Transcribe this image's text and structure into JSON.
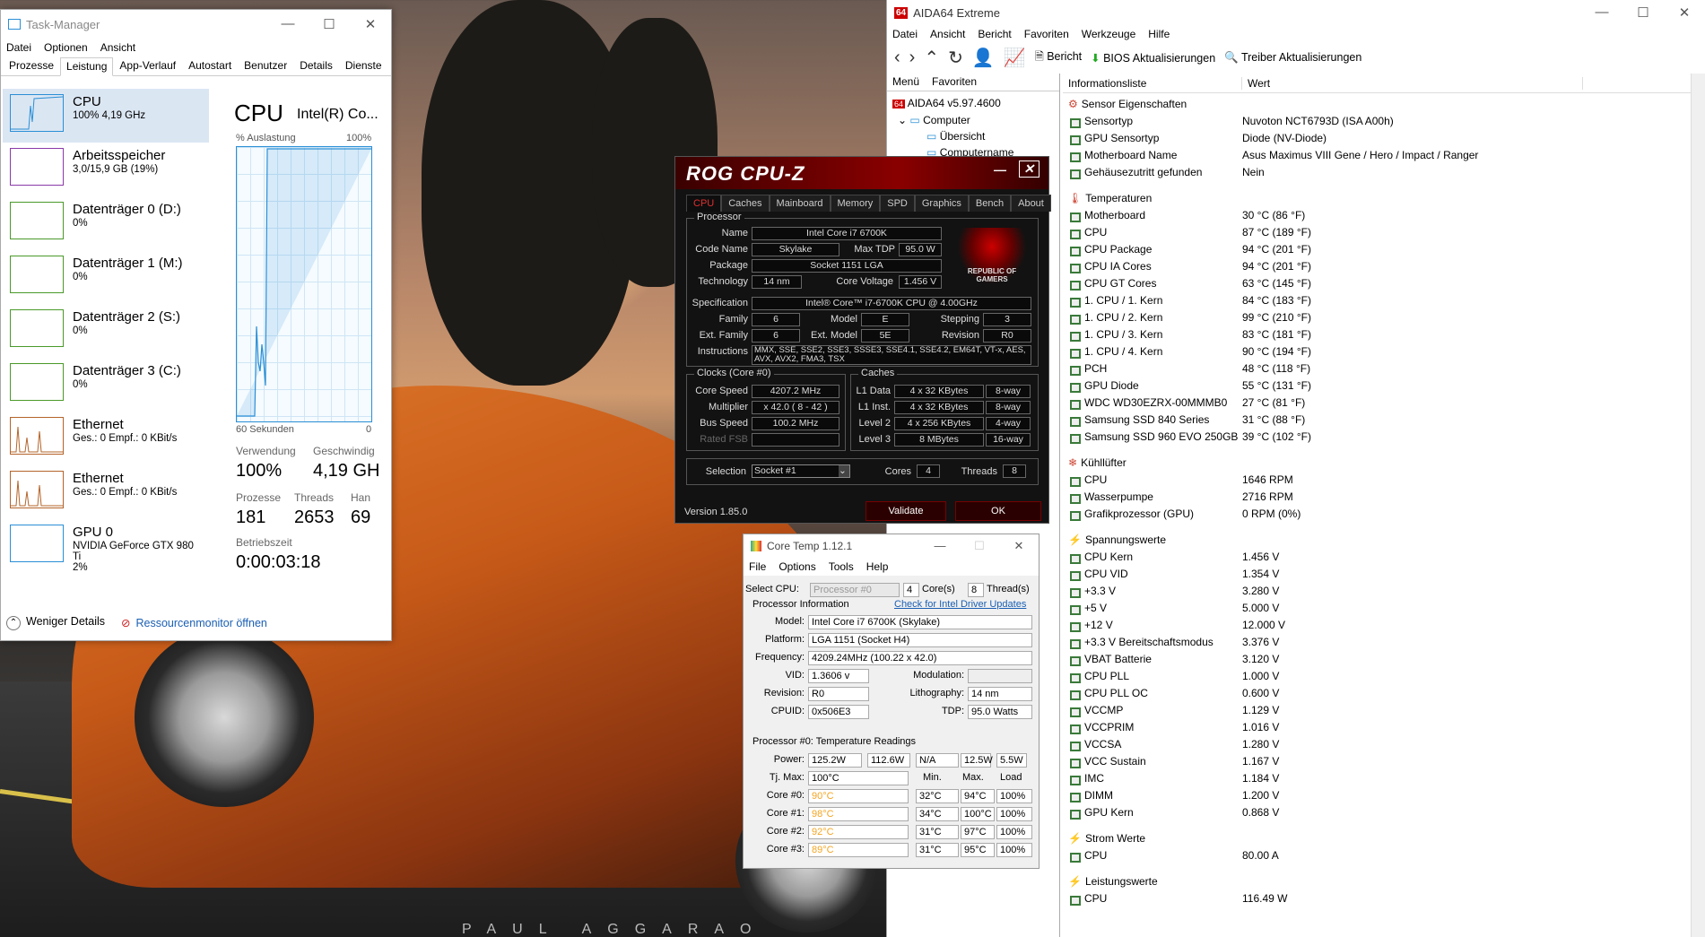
{
  "wallpaper": {
    "signature": "PAUL AGGARAO"
  },
  "taskmanager": {
    "title": "Task-Manager",
    "menu": [
      "Datei",
      "Optionen",
      "Ansicht"
    ],
    "tabs": [
      "Prozesse",
      "Leistung",
      "App-Verlauf",
      "Autostart",
      "Benutzer",
      "Details",
      "Dienste"
    ],
    "active_tab": "Leistung",
    "items": [
      {
        "name": "CPU",
        "sub": "100% 4,19 GHz",
        "color": "#2a8fd6"
      },
      {
        "name": "Arbeitsspeicher",
        "sub": "3,0/15,9 GB (19%)",
        "color": "#8b3aa8"
      },
      {
        "name": "Datenträger 0 (D:)",
        "sub": "0%",
        "color": "#4a9a2a"
      },
      {
        "name": "Datenträger 1 (M:)",
        "sub": "0%",
        "color": "#4a9a2a"
      },
      {
        "name": "Datenträger 2 (S:)",
        "sub": "0%",
        "color": "#4a9a2a"
      },
      {
        "name": "Datenträger 3 (C:)",
        "sub": "0%",
        "color": "#4a9a2a"
      },
      {
        "name": "Ethernet",
        "sub": "Ges.: 0 Empf.: 0 KBit/s",
        "color": "#b4642a"
      },
      {
        "name": "Ethernet",
        "sub": "Ges.: 0 Empf.: 0 KBit/s",
        "color": "#b4642a"
      },
      {
        "name": "GPU 0",
        "sub": "NVIDIA GeForce GTX 980 Ti",
        "sub2": "2%",
        "color": "#2a8fd6"
      }
    ],
    "detail": {
      "title": "CPU",
      "model": "Intel(R) Co...",
      "util_label": "% Auslastung",
      "util_max": "100%",
      "x_left": "60 Sekunden",
      "x_right": "0",
      "use_label": "Verwendung",
      "use_val": "100%",
      "speed_label": "Geschwindig",
      "speed_val": "4,19 GH",
      "proc_label": "Prozesse",
      "proc_val": "181",
      "threads_label": "Threads",
      "threads_val": "2653",
      "han_label": "Han",
      "han_val": "69",
      "uptime_label": "Betriebszeit",
      "uptime_val": "0:00:03:18"
    },
    "footer": {
      "less": "Weniger Details",
      "monitor": "Ressourcenmonitor öffnen"
    }
  },
  "aida": {
    "title": "AIDA64 Extreme",
    "menu": [
      "Datei",
      "Ansicht",
      "Bericht",
      "Favoriten",
      "Werkzeuge",
      "Hilfe"
    ],
    "toolbar": {
      "report": "Bericht",
      "bios": "BIOS Aktualisierungen",
      "driver": "Treiber Aktualisierungen"
    },
    "tabs": [
      "Menü",
      "Favoriten"
    ],
    "tree": [
      "AIDA64 v5.97.4600",
      "Computer",
      "Übersicht",
      "Computername"
    ],
    "col_info": "Informationsliste",
    "col_val": "Wert",
    "sections": [
      {
        "title": "Sensor Eigenschaften",
        "rows": [
          [
            "Sensortyp",
            "Nuvoton NCT6793D  (ISA A00h)"
          ],
          [
            "GPU Sensortyp",
            "Diode  (NV-Diode)"
          ],
          [
            "Motherboard Name",
            "Asus Maximus VIII Gene / Hero / Impact / Ranger"
          ],
          [
            "Gehäusezutritt gefunden",
            "Nein"
          ]
        ]
      },
      {
        "title": "Temperaturen",
        "rows": [
          [
            "Motherboard",
            "30 °C  (86 °F)"
          ],
          [
            "CPU",
            "87 °C  (189 °F)"
          ],
          [
            "CPU Package",
            "94 °C  (201 °F)"
          ],
          [
            "CPU IA Cores",
            "94 °C  (201 °F)"
          ],
          [
            "CPU GT Cores",
            "63 °C  (145 °F)"
          ],
          [
            "1. CPU / 1. Kern",
            "84 °C  (183 °F)"
          ],
          [
            "1. CPU / 2. Kern",
            "99 °C  (210 °F)"
          ],
          [
            "1. CPU / 3. Kern",
            "83 °C  (181 °F)"
          ],
          [
            "1. CPU / 4. Kern",
            "90 °C  (194 °F)"
          ],
          [
            "PCH",
            "48 °C  (118 °F)"
          ],
          [
            "GPU Diode",
            "55 °C  (131 °F)"
          ],
          [
            "WDC WD30EZRX-00MMMB0",
            "27 °C  (81 °F)"
          ],
          [
            "Samsung SSD 840 Series",
            "31 °C  (88 °F)"
          ],
          [
            "Samsung SSD 960 EVO 250GB",
            "39 °C  (102 °F)"
          ]
        ]
      },
      {
        "title": "Kühllüfter",
        "rows": [
          [
            "CPU",
            "1646 RPM"
          ],
          [
            "Wasserpumpe",
            "2716 RPM"
          ],
          [
            "Grafikprozessor (GPU)",
            "0 RPM  (0%)"
          ]
        ]
      },
      {
        "title": "Spannungswerte",
        "rows": [
          [
            "CPU Kern",
            "1.456 V"
          ],
          [
            "CPU VID",
            "1.354 V"
          ],
          [
            "+3.3 V",
            "3.280 V"
          ],
          [
            "+5 V",
            "5.000 V"
          ],
          [
            "+12 V",
            "12.000 V"
          ],
          [
            "+3.3 V Bereitschaftsmodus",
            "3.376 V"
          ],
          [
            "VBAT Batterie",
            "3.120 V"
          ],
          [
            "CPU PLL",
            "1.000 V"
          ],
          [
            "CPU PLL OC",
            "0.600 V"
          ],
          [
            "VCCMP",
            "1.129 V"
          ],
          [
            "VCCPRIM",
            "1.016 V"
          ],
          [
            "VCCSA",
            "1.280 V"
          ],
          [
            "VCC Sustain",
            "1.167 V"
          ],
          [
            "IMC",
            "1.184 V"
          ],
          [
            "DIMM",
            "1.200 V"
          ],
          [
            "GPU Kern",
            "0.868 V"
          ]
        ]
      },
      {
        "title": "Strom Werte",
        "rows": [
          [
            "CPU",
            "80.00 A"
          ]
        ]
      },
      {
        "title": "Leistungswerte",
        "rows": [
          [
            "CPU",
            "116.49 W"
          ]
        ]
      }
    ]
  },
  "cpuz": {
    "title": "ROG CPU-Z",
    "tabs": [
      "CPU",
      "Caches",
      "Mainboard",
      "Memory",
      "SPD",
      "Graphics",
      "Bench",
      "About"
    ],
    "processor_label": "Processor",
    "logo": "REPUBLIC OF GAMERS",
    "fields": {
      "name_l": "Name",
      "name": "Intel Core i7 6700K",
      "code_l": "Code Name",
      "code": "Skylake",
      "tdp_l": "Max TDP",
      "tdp": "95.0 W",
      "pkg_l": "Package",
      "pkg": "Socket 1151 LGA",
      "tech_l": "Technology",
      "tech": "14 nm",
      "cv_l": "Core Voltage",
      "cv": "1.456 V",
      "spec_l": "Specification",
      "spec": "Intel® Core™ i7-6700K CPU @ 4.00GHz",
      "fam_l": "Family",
      "fam": "6",
      "mod_l": "Model",
      "mod": "E",
      "step_l": "Stepping",
      "step": "3",
      "efam_l": "Ext. Family",
      "efam": "6",
      "emod_l": "Ext. Model",
      "emod": "5E",
      "rev_l": "Revision",
      "rev": "R0",
      "ins_l": "Instructions",
      "ins": "MMX, SSE, SSE2, SSE3, SSSE3, SSE4.1, SSE4.2, EM64T, VT-x, AES, AVX, AVX2, FMA3, TSX"
    },
    "clocks": {
      "title": "Clocks (Core #0)",
      "cs_l": "Core Speed",
      "cs": "4207.2 MHz",
      "mul_l": "Multiplier",
      "mul": "x 42.0 ( 8 - 42 )",
      "bus_l": "Bus Speed",
      "bus": "100.2 MHz",
      "fsb_l": "Rated FSB",
      "fsb": ""
    },
    "caches": {
      "title": "Caches",
      "l1d_l": "L1 Data",
      "l1d": "4 x 32 KBytes",
      "l1d_w": "8-way",
      "l1i_l": "L1 Inst.",
      "l1i": "4 x 32 KBytes",
      "l1i_w": "8-way",
      "l2_l": "Level 2",
      "l2": "4 x 256 KBytes",
      "l2_w": "4-way",
      "l3_l": "Level 3",
      "l3": "8 MBytes",
      "l3_w": "16-way"
    },
    "sel_l": "Selection",
    "sel": "Socket #1",
    "cores_l": "Cores",
    "cores": "4",
    "threads_l": "Threads",
    "threads": "8",
    "version": "Version 1.85.0",
    "validate": "Validate",
    "ok": "OK"
  },
  "coretemp": {
    "title": "Core Temp 1.12.1",
    "menu": [
      "File",
      "Options",
      "Tools",
      "Help"
    ],
    "selcpu_l": "Select CPU:",
    "selcpu": "Processor #0",
    "cores": "4",
    "cores_l": "Core(s)",
    "threads": "8",
    "threads_l": "Thread(s)",
    "pinfo": "Processor Information",
    "link": "Check for Intel Driver Updates",
    "model_l": "Model:",
    "model": "Intel Core i7 6700K (Skylake)",
    "plat_l": "Platform:",
    "plat": "LGA 1151 (Socket H4)",
    "freq_l": "Frequency:",
    "freq": "4209.24MHz (100.22 x 42.0)",
    "vid_l": "VID:",
    "vid": "1.3606 v",
    "modu_l": "Modulation:",
    "rev_l": "Revision:",
    "rev": "R0",
    "lith_l": "Lithography:",
    "lith": "14 nm",
    "cpuid_l": "CPUID:",
    "cpuid": "0x506E3",
    "tdp_l": "TDP:",
    "tdp": "95.0 Watts",
    "readings": "Processor #0: Temperature Readings",
    "power_l": "Power:",
    "power": [
      "125.2W",
      "112.6W",
      "N/A",
      "12.5W",
      "5.5W"
    ],
    "tj_l": "Tj. Max:",
    "tj": "100°C",
    "min_l": "Min.",
    "max_l": "Max.",
    "load_l": "Load",
    "cores_rows": [
      [
        "Core #0:",
        "90°C",
        "32°C",
        "94°C",
        "100%"
      ],
      [
        "Core #1:",
        "98°C",
        "34°C",
        "100°C",
        "100%"
      ],
      [
        "Core #2:",
        "92°C",
        "31°C",
        "97°C",
        "100%"
      ],
      [
        "Core #3:",
        "89°C",
        "31°C",
        "95°C",
        "100%"
      ]
    ]
  }
}
